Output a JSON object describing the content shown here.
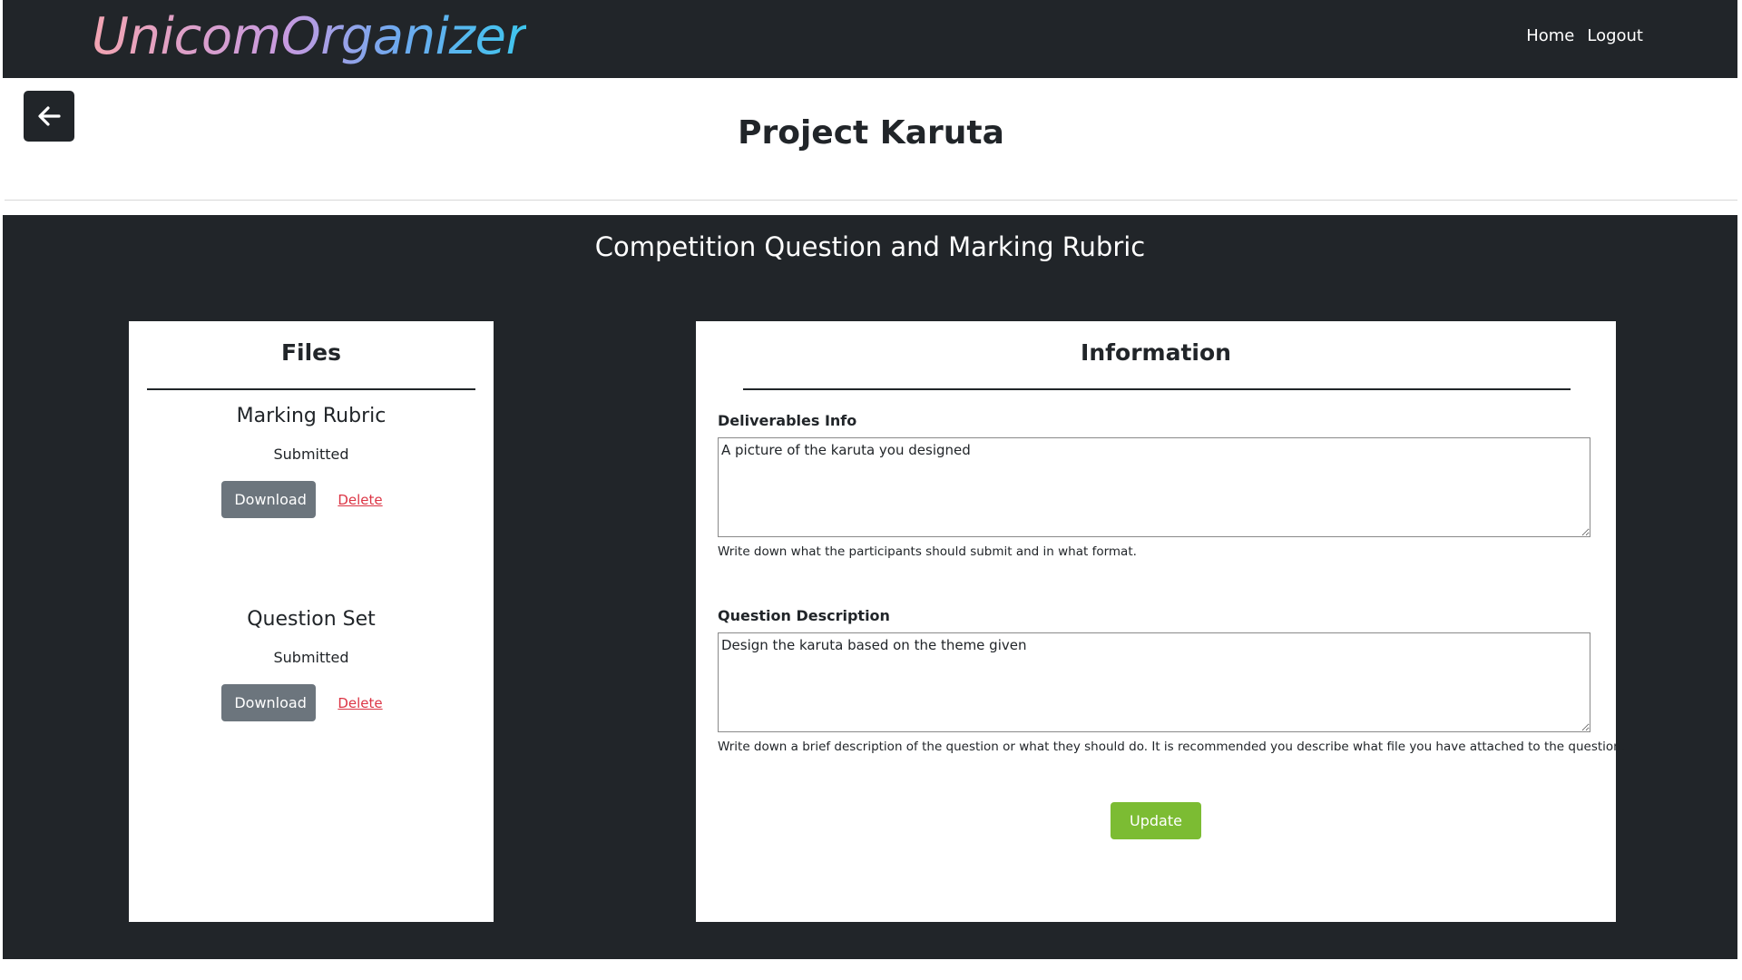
{
  "navbar": {
    "brand": "UnicomOrganizer",
    "links": [
      "Home",
      "Logout"
    ]
  },
  "back_button": {
    "icon": "arrow-left-icon"
  },
  "page_title": "Project Karuta",
  "section": {
    "title": "Competition Question and Marking Rubric",
    "files": {
      "title": "Files",
      "items": [
        {
          "name": "Marking Rubric",
          "status": "Submitted",
          "download_label": "Download",
          "delete_label": "Delete"
        },
        {
          "name": "Question Set",
          "status": "Submitted",
          "download_label": "Download",
          "delete_label": "Delete"
        }
      ]
    },
    "information": {
      "title": "Information",
      "deliverables": {
        "label": "Deliverables Info",
        "value": "A picture of the karuta you designed",
        "help": "Write down what the participants should submit and in what format."
      },
      "question": {
        "label": "Question Description",
        "value": "Design the karuta based on the theme given",
        "help": "Write down a brief description of the question or what they should do. It is recommended you describe what file you have attached to the question."
      },
      "update_label": "Update"
    }
  },
  "colors": {
    "dark": "#212529",
    "download_button": "#6c757d",
    "delete_link": "#dc3545",
    "update_button": "#7cbc33"
  }
}
